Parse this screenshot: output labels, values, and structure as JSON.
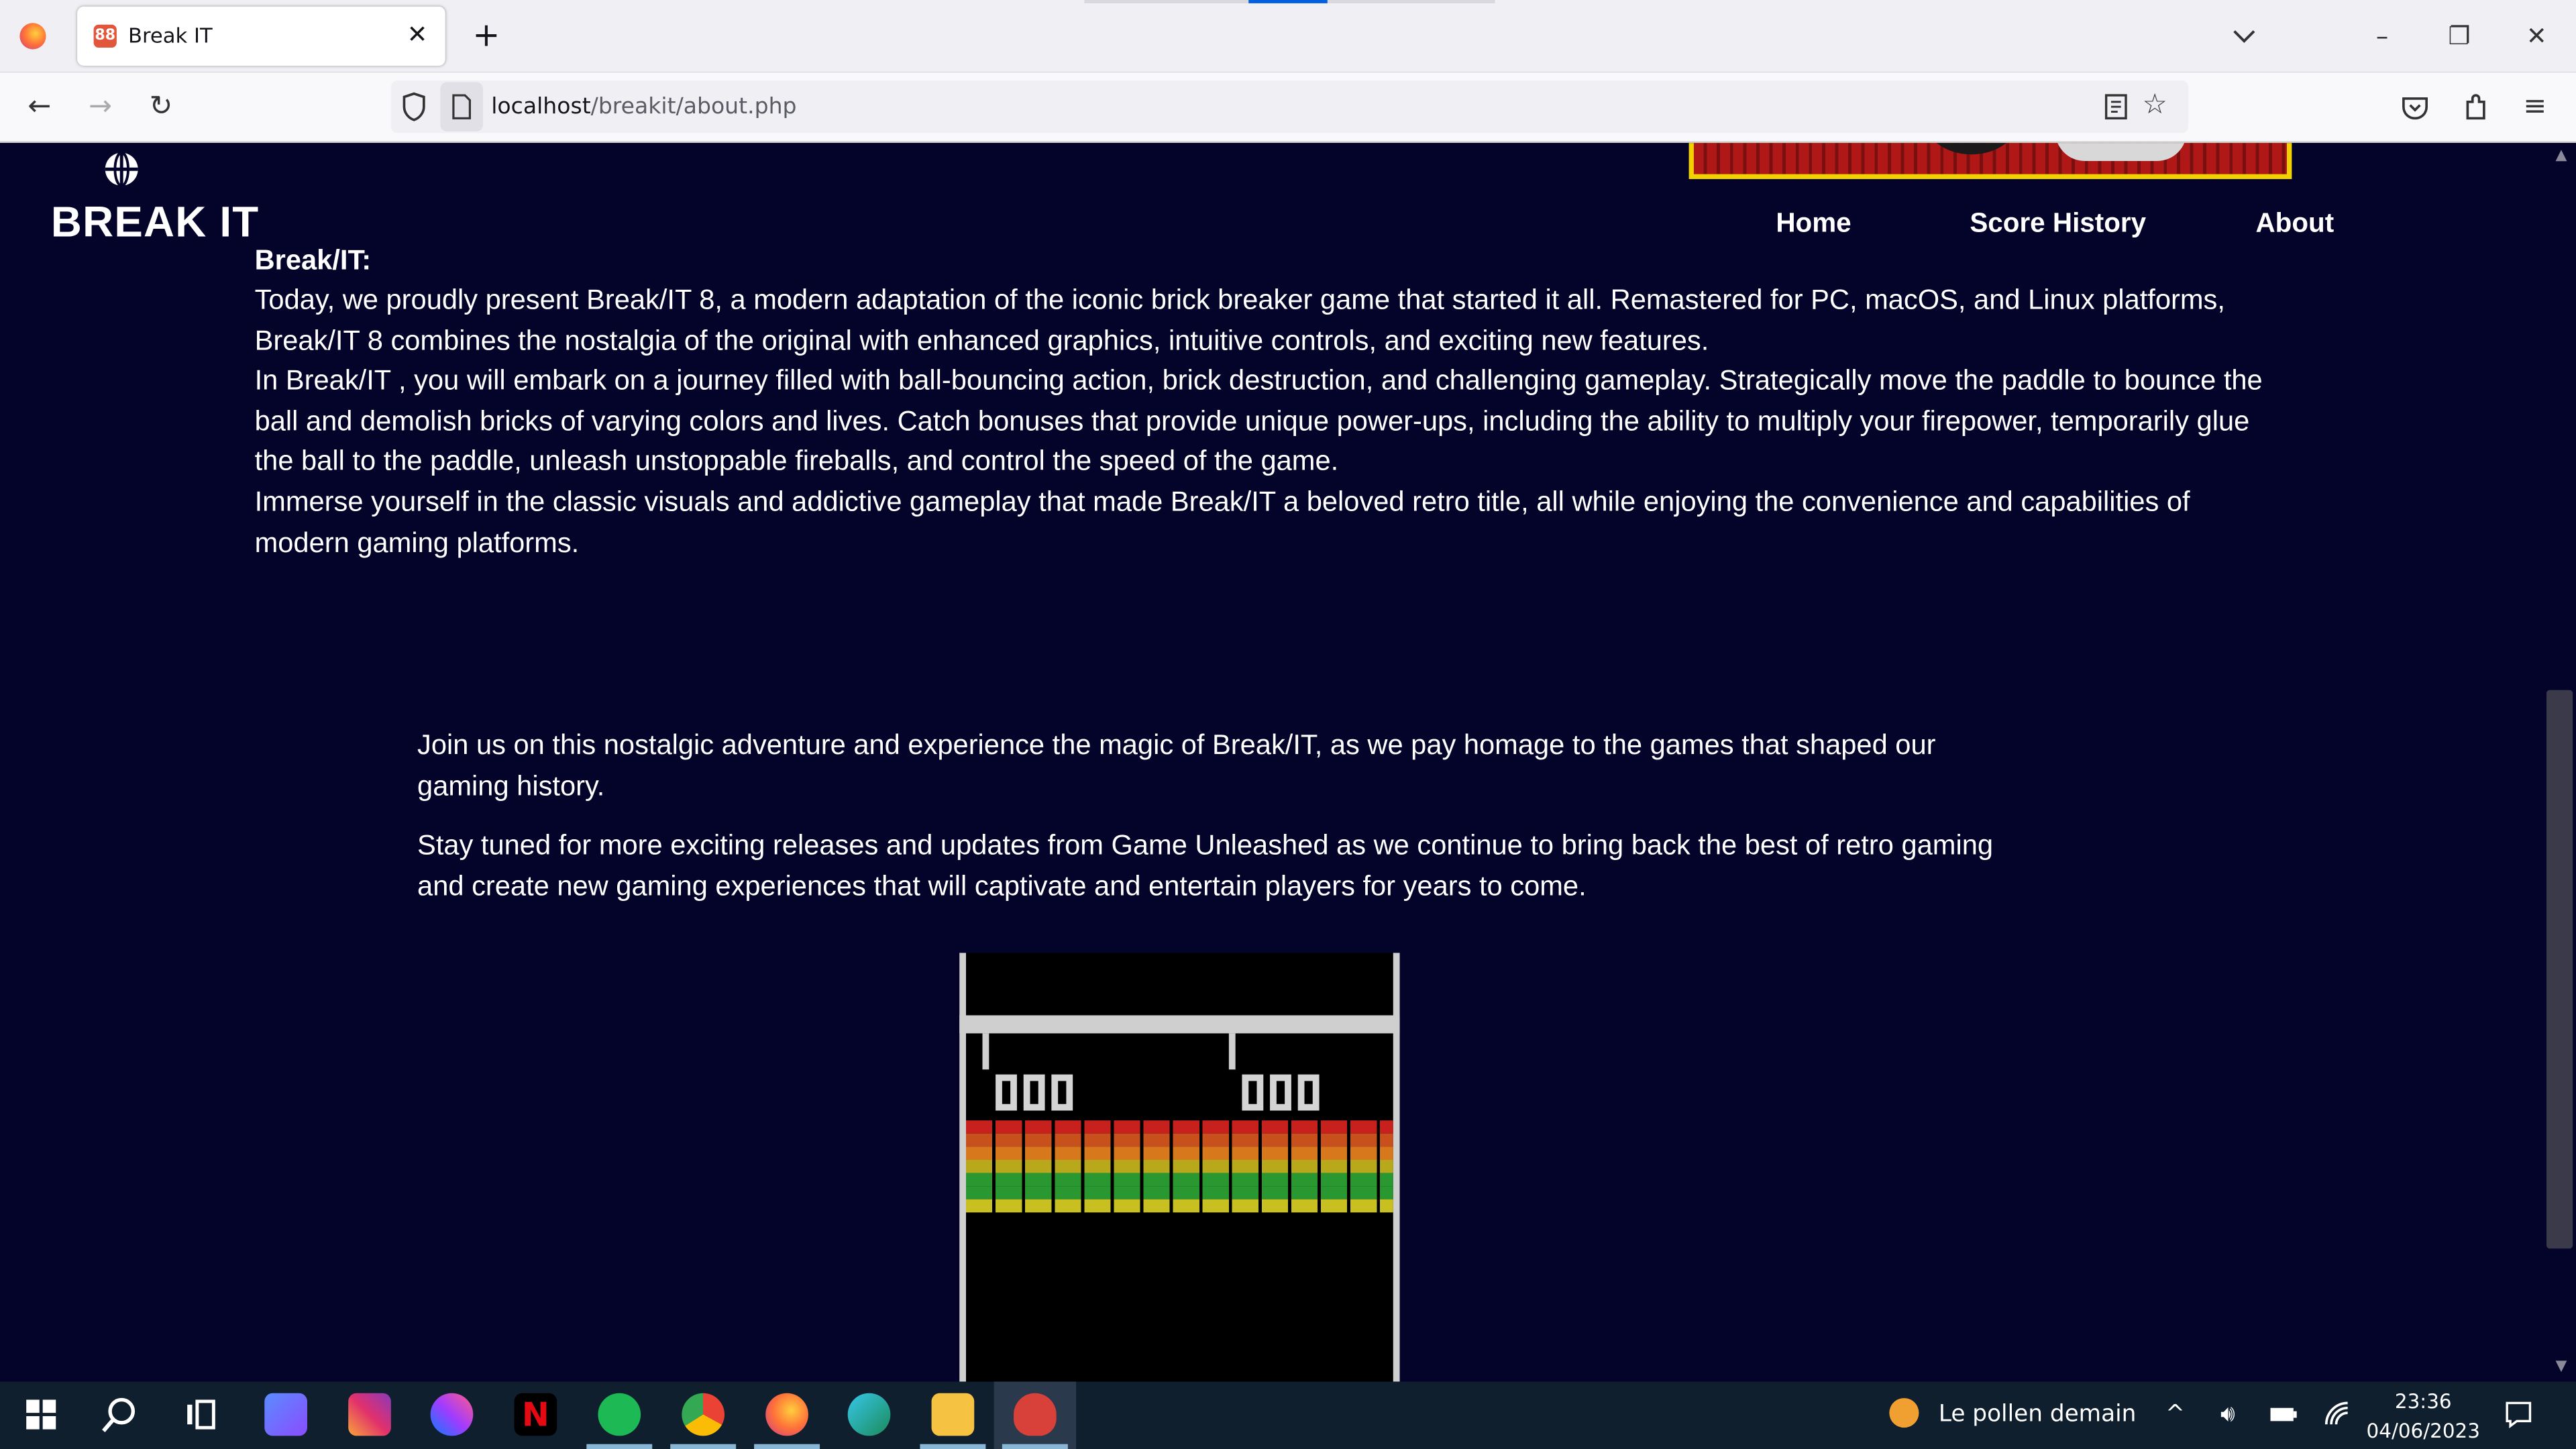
{
  "browser": {
    "tab_title": "Break IT",
    "tab_close": "✕",
    "new_tab": "+",
    "favicon_text": "88",
    "url_host": "localhost",
    "url_path": "/breakit/about.php"
  },
  "site": {
    "brand": "BREAK IT",
    "nav": [
      "Home",
      "Score History",
      "About"
    ]
  },
  "content": {
    "heading": "Break/IT:",
    "p1": "Today, we proudly present Break/IT 8, a modern adaptation of the iconic brick breaker game that started it all. Remastered for PC, macOS, and Linux platforms, Break/IT 8 combines the nostalgia of the original with enhanced graphics, intuitive controls, and exciting new features.",
    "p2": "In Break/IT , you will embark on a journey filled with ball-bouncing action, brick destruction, and challenging gameplay. Strategically move the paddle to bounce the ball and demolish bricks of varying colors and lives. Catch bonuses that provide unique power-ups, including the ability to multiply your firepower, temporarily glue the ball to the paddle, unleash unstoppable fireballs, and control the speed of the game.",
    "p3": "Immerse yourself in the classic visuals and addictive gameplay that made Break/IT a beloved retro title, all while enjoying the convenience and capabilities of modern gaming platforms.",
    "p4": "Join us on this nostalgic adventure and experience the magic of Break/IT, as we pay homage to the games that shaped our gaming history.",
    "p5": "Stay tuned for more exciting releases and updates from Game Unleashed as we continue to bring back the best of retro gaming and create new gaming experiences that will captivate and entertain players for years to come."
  },
  "game": {
    "brick_colors": [
      "#c8201c",
      "#c8501c",
      "#d8781c",
      "#b8a81c",
      "#2a9830",
      "#2a9830",
      "#c8c020"
    ]
  },
  "taskbar": {
    "weather_text": "Le pollen demain",
    "time": "23:36",
    "date": "04/06/2023"
  }
}
